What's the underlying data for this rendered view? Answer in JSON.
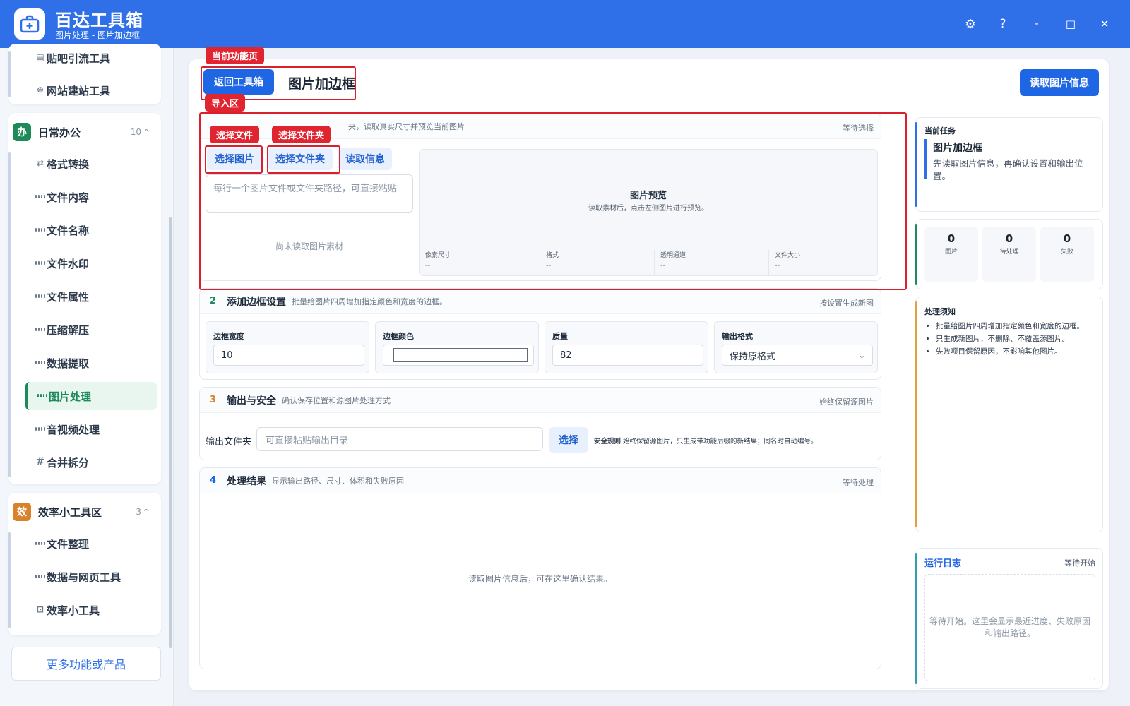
{
  "app": {
    "title": "百达工具箱",
    "subtitle": "图片处理 - 图片加边框",
    "brand_color": "#2f6fe8"
  },
  "window_controls": {
    "settings": "⚙",
    "help": "?",
    "minimize": "-",
    "maximize": "□",
    "close": "✕"
  },
  "sidebar": {
    "top_items": [
      {
        "label": "贴吧引流工具",
        "icon": "doc-icon"
      },
      {
        "label": "网站建站工具",
        "icon": "globe-icon"
      }
    ],
    "groups": [
      {
        "badge": "办",
        "badge_color": "#1e8a5a",
        "title": "日常办公",
        "count": "10",
        "items": [
          {
            "label": "格式转换",
            "icon": "swap-icon"
          },
          {
            "label": "文件内容",
            "icon": "grid-icon"
          },
          {
            "label": "文件名称",
            "icon": "grid-icon"
          },
          {
            "label": "文件水印",
            "icon": "grid-icon"
          },
          {
            "label": "文件属性",
            "icon": "grid-icon"
          },
          {
            "label": "压缩解压",
            "icon": "grid-icon"
          },
          {
            "label": "数据提取",
            "icon": "grid-icon"
          },
          {
            "label": "图片处理",
            "icon": "grid-icon",
            "active": true
          },
          {
            "label": "音视频处理",
            "icon": "grid-icon"
          },
          {
            "label": "合并拆分",
            "icon": "hash-icon"
          }
        ]
      },
      {
        "badge": "效",
        "badge_color": "#d9822b",
        "title": "效率小工具区",
        "count": "3",
        "items": [
          {
            "label": "文件整理",
            "icon": "grid-icon"
          },
          {
            "label": "数据与网页工具",
            "icon": "grid-icon"
          },
          {
            "label": "效率小工具",
            "icon": "toolbox-icon"
          }
        ]
      }
    ],
    "more_label": "更多功能或产品"
  },
  "main": {
    "back_label": "返回工具箱",
    "page_title": "图片加边框",
    "read_info_label": "读取图片信息",
    "annotations": {
      "current_page": "当前功能页",
      "import_area": "导入区",
      "select_file": "选择文件",
      "select_folder": "选择文件夹"
    },
    "section1": {
      "desc_visible": "夹，读取真实尺寸并预览当前图片",
      "status": "等待选择",
      "buttons": {
        "pick_image": "选择图片",
        "pick_folder": "选择文件夹",
        "read_info": "读取信息"
      },
      "textarea_placeholder": "每行一个图片文件或文件夹路径，可直接粘贴",
      "empty_text": "尚未读取图片素材",
      "preview_title": "图片预览",
      "preview_hint": "读取素材后，点击左侧图片进行预览。",
      "meta": [
        {
          "key": "像素尺寸",
          "value": "--"
        },
        {
          "key": "格式",
          "value": "--"
        },
        {
          "key": "透明通道",
          "value": "--"
        },
        {
          "key": "文件大小",
          "value": "--"
        }
      ]
    },
    "section2": {
      "num": "2",
      "title": "添加边框设置",
      "desc": "批量给图片四周增加指定颜色和宽度的边框。",
      "status": "按设置生成新图",
      "fields": {
        "border_width": {
          "label": "边框宽度",
          "value": "10"
        },
        "border_color": {
          "label": "边框颜色",
          "value": "#ffffff"
        },
        "quality": {
          "label": "质量",
          "value": "82"
        },
        "output_format": {
          "label": "输出格式",
          "value": "保持原格式"
        }
      }
    },
    "section3": {
      "num": "3",
      "title": "输出与安全",
      "desc": "确认保存位置和源图片处理方式",
      "status": "始终保留源图片",
      "folder_label": "输出文件夹",
      "folder_placeholder": "可直接粘贴输出目录",
      "choose_label": "选择",
      "rule_title": "安全规则",
      "rule_text": "始终保留源图片，只生成带功能后缀的新结果；同名时自动编号。"
    },
    "section4": {
      "num": "4",
      "title": "处理结果",
      "desc": "显示输出路径、尺寸、体积和失败原因",
      "status": "等待处理",
      "empty_text": "读取图片信息后，可在这里确认结果。"
    }
  },
  "right": {
    "task_label": "当前任务",
    "task_title": "图片加边框",
    "task_desc": "先读取图片信息，再确认设置和输出位置。",
    "stats": [
      {
        "value": "0",
        "label": "图片"
      },
      {
        "value": "0",
        "label": "待处理"
      },
      {
        "value": "0",
        "label": "失败"
      }
    ],
    "notes_title": "处理须知",
    "notes": [
      "批量给图片四周增加指定颜色和宽度的边框。",
      "只生成新图片，不删除、不覆盖源图片。",
      "失败项目保留原因，不影响其他图片。"
    ],
    "log_title": "运行日志",
    "log_status": "等待开始",
    "log_empty": "等待开始。这里会显示最近进度、失败原因和输出路径。"
  }
}
